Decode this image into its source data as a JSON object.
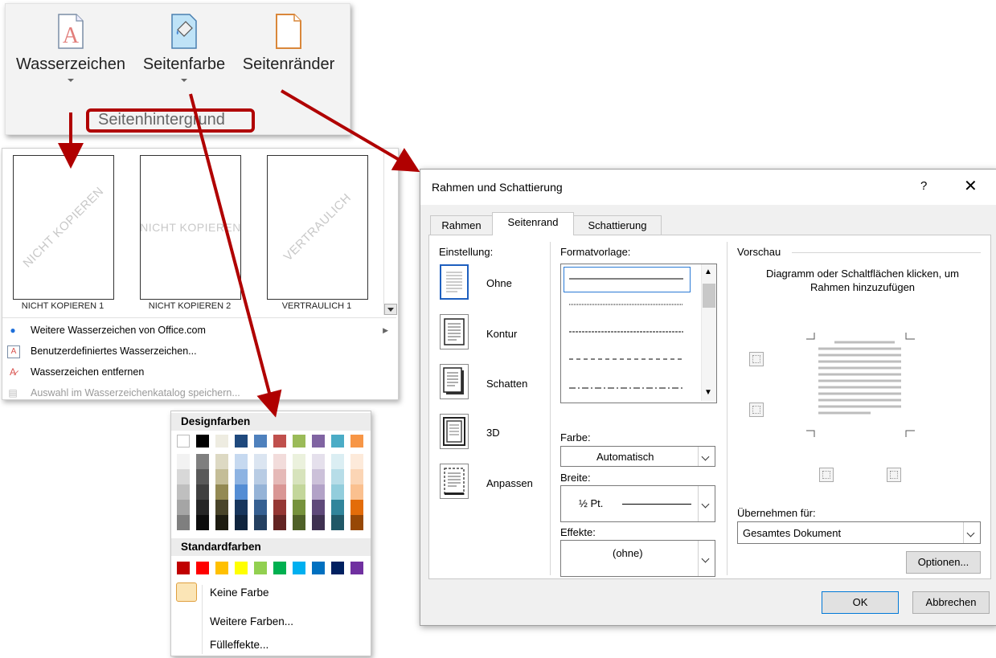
{
  "ribbon": {
    "buttons": [
      {
        "label": "Wasserzeichen",
        "icon": "watermark-icon"
      },
      {
        "label": "Seitenfarbe",
        "icon": "page-color-icon"
      },
      {
        "label": "Seitenränder",
        "icon": "page-borders-icon"
      }
    ],
    "group_label": "Seitenhintergrund"
  },
  "watermark_gallery": {
    "thumbnails": [
      {
        "watermark_text": "NICHT KOPIEREN",
        "label": "NICHT KOPIEREN 1",
        "orientation": "diagonal"
      },
      {
        "watermark_text": "NICHT KOPIEREN",
        "label": "NICHT KOPIEREN 2",
        "orientation": "horizontal"
      },
      {
        "watermark_text": "VERTRAULICH",
        "label": "VERTRAULICH 1",
        "orientation": "diagonal"
      }
    ],
    "menu_items": [
      {
        "label": "Weitere Wasserzeichen von Office.com",
        "icon": "office-globe-icon",
        "enabled": true,
        "has_submenu": true
      },
      {
        "label": "Benutzerdefiniertes Wasserzeichen...",
        "icon": "custom-watermark-icon",
        "enabled": true
      },
      {
        "label": "Wasserzeichen entfernen",
        "icon": "remove-watermark-icon",
        "enabled": true
      },
      {
        "label": "Auswahl im Wasserzeichenkatalog speichern...",
        "icon": "save-to-gallery-icon",
        "enabled": false
      }
    ]
  },
  "color_picker": {
    "theme_header": "Designfarben",
    "theme_top_row": [
      "#ffffff",
      "#000000",
      "#eeece1",
      "#1f497d",
      "#4f81bd",
      "#c0504d",
      "#9bbb59",
      "#8064a2",
      "#4bacc6",
      "#f79646"
    ],
    "theme_shades": [
      [
        "#f2f2f2",
        "#7f7f7f",
        "#ddd9c3",
        "#c6d9f0",
        "#dbe5f1",
        "#f2dcdb",
        "#ebf1dd",
        "#e5e0ec",
        "#dbeef3",
        "#fdeada"
      ],
      [
        "#d8d8d8",
        "#595959",
        "#c4bd97",
        "#8db3e2",
        "#b8cce4",
        "#e5b9b7",
        "#d7e3bc",
        "#ccc1d9",
        "#b7dde8",
        "#fbd5b5"
      ],
      [
        "#bfbfbf",
        "#3f3f3f",
        "#938953",
        "#548dd4",
        "#95b3d7",
        "#d99694",
        "#c3d69b",
        "#b2a2c7",
        "#92cddc",
        "#fac08f"
      ],
      [
        "#a5a5a5",
        "#262626",
        "#494429",
        "#17365d",
        "#366092",
        "#953734",
        "#76923c",
        "#5f497a",
        "#31859b",
        "#e36c09"
      ],
      [
        "#7f7f7f",
        "#0c0c0c",
        "#1d1b10",
        "#0f243e",
        "#244061",
        "#632423",
        "#4f6128",
        "#3f3151",
        "#205867",
        "#974806"
      ]
    ],
    "standard_header": "Standardfarben",
    "standard_colors": [
      "#c00000",
      "#ff0000",
      "#ffc000",
      "#ffff00",
      "#92d050",
      "#00b050",
      "#00b0f0",
      "#0070c0",
      "#002060",
      "#7030a0"
    ],
    "no_color_label": "Keine Farbe",
    "more_colors_label": "Weitere Farben...",
    "fill_effects_label": "Fülleffekte...",
    "no_color_swatch": "#fbe5b6"
  },
  "dialog": {
    "title": "Rahmen und Schattierung",
    "help_glyph": "?",
    "close_glyph": "✕",
    "tabs": [
      {
        "label": "Rahmen",
        "active": false
      },
      {
        "label": "Seitenrand",
        "active": true
      },
      {
        "label": "Schattierung",
        "active": false
      }
    ],
    "einstellung_label": "Einstellung:",
    "settings": [
      {
        "label": "Ohne",
        "icon": "border-none-icon",
        "selected": true
      },
      {
        "label": "Kontur",
        "icon": "border-box-icon",
        "selected": false
      },
      {
        "label": "Schatten",
        "icon": "border-shadow-icon",
        "selected": false
      },
      {
        "label": "3D",
        "icon": "border-3d-icon",
        "selected": false
      },
      {
        "label": "Anpassen",
        "icon": "border-custom-icon",
        "selected": false
      }
    ],
    "formatvorlage_label": "Formatvorlage:",
    "styles": [
      "solid",
      "dotted",
      "dashed-fine",
      "dashed",
      "dash-dot"
    ],
    "farbe_label": "Farbe:",
    "farbe_value": "Automatisch",
    "breite_label": "Breite:",
    "breite_value": "½ Pt.",
    "effekte_label": "Effekte:",
    "effekte_value": "(ohne)",
    "vorschau_label": "Vorschau",
    "vorschau_hint": "Diagramm oder Schaltflächen klicken, um Rahmen hinzuzufügen",
    "uebernehmen_label": "Übernehmen für:",
    "uebernehmen_value": "Gesamtes Dokument",
    "optionen_label": "Optionen...",
    "ok_label": "OK",
    "cancel_label": "Abbrechen"
  },
  "annotation_color": "#b00000"
}
